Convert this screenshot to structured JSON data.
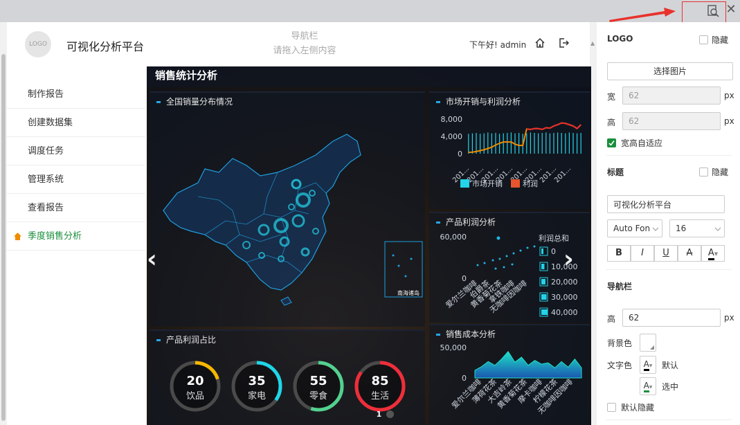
{
  "header": {
    "logo_text": "LOGO",
    "app_title": "可视化分析平台",
    "nav_hint_line1": "导航栏",
    "nav_hint_line2": "请拖入左侧内容",
    "greeting": "下午好! admin"
  },
  "sidebar": {
    "items": [
      {
        "label": "制作报告"
      },
      {
        "label": "创建数据集"
      },
      {
        "label": "调度任务"
      },
      {
        "label": "管理系统"
      },
      {
        "label": "查看报告"
      },
      {
        "label": "季度销售分析",
        "active": true
      }
    ]
  },
  "dashboard": {
    "title": "销售统计分析",
    "map_panel_title": "全国销量分布情况",
    "map_inset_label": "南海诸岛",
    "donut_panel_title": "产品利润占比",
    "donuts": [
      {
        "value": "20",
        "label": "饮品",
        "color": "#f5b700",
        "fraction": 0.2
      },
      {
        "value": "35",
        "label": "家电",
        "color": "#1ed6e8",
        "fraction": 0.35
      },
      {
        "value": "55",
        "label": "零食",
        "color": "#52d18e",
        "fraction": 0.55
      },
      {
        "value": "85",
        "label": "生活",
        "color": "#ef2e3a",
        "fraction": 0.85
      }
    ],
    "pager": {
      "current": "1"
    }
  },
  "chart_data": [
    {
      "type": "line",
      "title": "市场开销与利润分析",
      "y_ticks": [
        "8,000",
        "4,000",
        "0"
      ],
      "ylim": [
        0,
        8000
      ],
      "x_tick_labels": [
        "201...",
        "201...",
        "201...",
        "201...",
        "201...",
        "201...",
        "201...",
        "201..."
      ],
      "legend": [
        "市场开销",
        "利润"
      ],
      "series": [
        {
          "name": "市场开销",
          "type": "bar",
          "values": [
            4600,
            4700,
            4800,
            4600,
            4700,
            4900,
            4700,
            4800,
            4600,
            4700,
            4800,
            4900,
            4700,
            4800,
            4600,
            4700,
            4900,
            4800,
            4700,
            4800,
            4900,
            4700,
            4800,
            4900,
            4800,
            4700,
            4900,
            4800,
            4700,
            4800
          ]
        },
        {
          "name": "利润",
          "type": "line",
          "values": [
            300,
            350,
            500,
            700,
            900,
            1200,
            1500,
            2000,
            2400,
            2700,
            2700,
            2700,
            2200,
            1900,
            1900,
            5700,
            5600,
            5800,
            5800,
            5600,
            6000,
            5900,
            6400,
            6700,
            7100,
            7000,
            6700,
            6400,
            5800,
            6700
          ]
        }
      ]
    },
    {
      "type": "scatter",
      "title": "产品利润分析",
      "y_ticks": [
        "60,000",
        "0"
      ],
      "legend_title": "利润总和",
      "legend": [
        "0",
        "10,000",
        "20,000",
        "30,000",
        "40,000"
      ],
      "categories": [
        "爱尔兰咖啡",
        "伯爵茶",
        "黄香菊花茶",
        "拿铁咖啡",
        "无咖啡因咖啡"
      ]
    },
    {
      "type": "area",
      "title": "销售成本分析",
      "y_ticks": [
        "50,000",
        "0"
      ],
      "categories": [
        "爱尔兰咖啡",
        "薄荷花茶",
        "大吉岭茶",
        "黄香菊花茶",
        "摩卡咖啡",
        "柠檬花茶",
        "无咖啡因咖啡"
      ],
      "values": [
        12000,
        18000,
        26000,
        20000,
        30000,
        42000,
        25000,
        33000,
        20000,
        28000,
        22000,
        24000,
        16000,
        26000,
        17000,
        30000,
        16000
      ]
    }
  ],
  "props": {
    "logo_section": "LOGO",
    "hide_label": "隐藏",
    "choose_image": "选择图片",
    "width_label": "宽",
    "width_value": "62",
    "height_label": "高",
    "height_value": "62",
    "unit_px": "px",
    "auto_fit_label": "宽高自适应",
    "title_section": "标题",
    "title_value": "可视化分析平台",
    "font_family": "Auto Fon",
    "font_size": "16",
    "fmt_bold": "B",
    "fmt_italic": "I",
    "fmt_underline": "U",
    "fmt_strike": "A",
    "fmt_color": "A",
    "nav_section": "导航栏",
    "nav_height_label": "高",
    "nav_height_value": "62",
    "bg_color_label": "背景色",
    "text_color_label": "文字色",
    "default_label": "默认",
    "selected_label": "选中",
    "default_hide_label": "默认隐藏"
  }
}
